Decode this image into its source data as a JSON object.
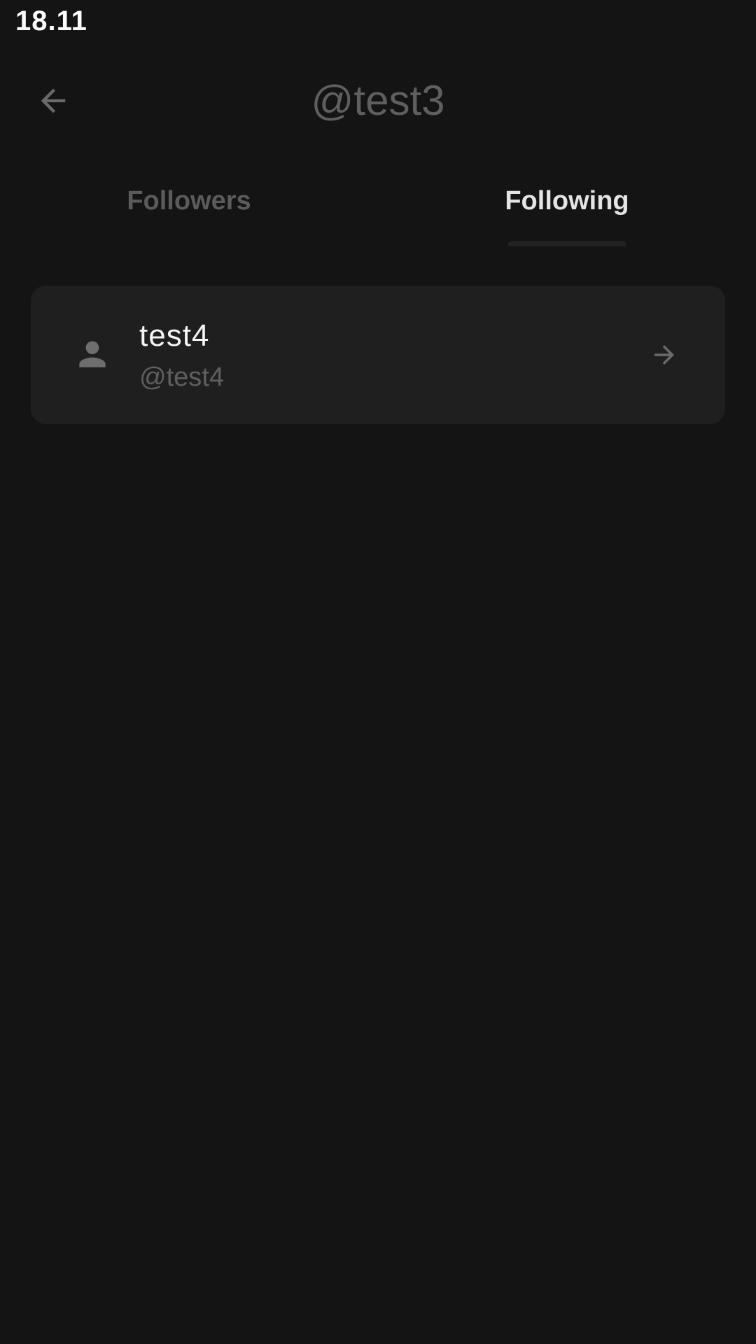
{
  "status_bar": {
    "time": "18.11"
  },
  "header": {
    "title": "@test3",
    "back_icon": "arrow-left-icon"
  },
  "tabs": [
    {
      "label": "Followers",
      "selected": false
    },
    {
      "label": "Following",
      "selected": true
    }
  ],
  "following_list": [
    {
      "name": "test4",
      "handle": "@test4",
      "avatar_icon": "person-icon",
      "action_icon": "arrow-right-icon"
    }
  ],
  "colors": {
    "background": "#141414",
    "card": "#1f1f1f",
    "muted_text": "#5f5f5f",
    "primary_text": "#ffffff"
  }
}
